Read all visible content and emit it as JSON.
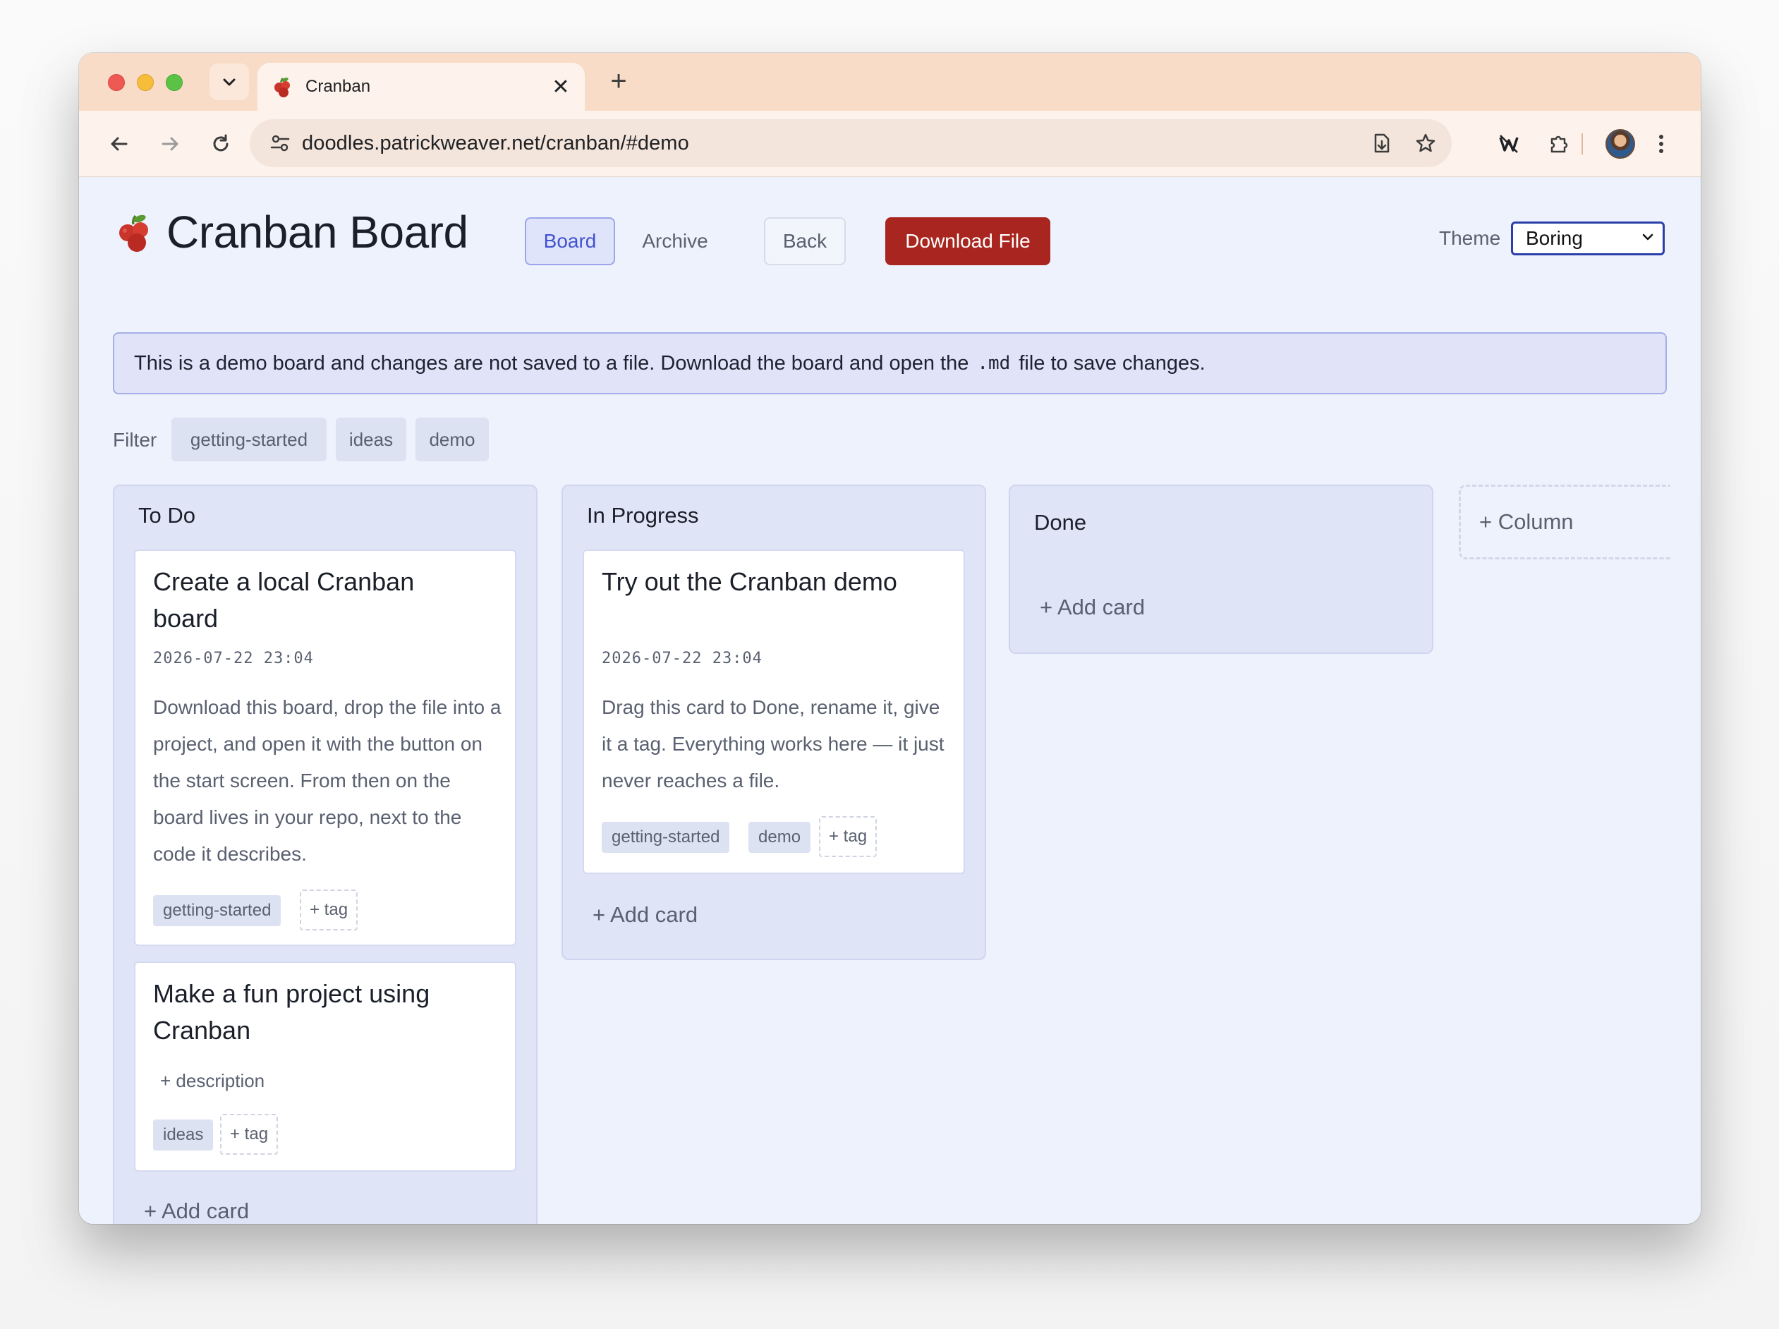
{
  "browser": {
    "tab_title": "Cranban",
    "url": "doodles.patrickweaver.net/cranban/#demo"
  },
  "app": {
    "title": "Cranban Board",
    "nav": {
      "board": "Board",
      "archive": "Archive",
      "back": "Back",
      "download": "Download File"
    },
    "theme": {
      "label": "Theme",
      "selected": "Boring"
    },
    "banner": {
      "text_before": "This is a demo board and changes are not saved to a file. Download the board and open the",
      "code": ".md",
      "text_after": "file to save changes."
    },
    "filter": {
      "label": "Filter",
      "tags": [
        "getting-started",
        "ideas",
        "demo"
      ]
    },
    "columns": [
      {
        "title": "To Do",
        "add_card": "+ Add card",
        "cards": [
          {
            "title": "Create a local Cranban board",
            "date": "2026-07-22 23:04",
            "description": "Download this board, drop the file into a project, and open it with the button on the start screen. From then on the board lives in your repo, next to the code it describes.",
            "tags": [
              "getting-started"
            ],
            "add_tag": "+ tag"
          },
          {
            "title": "Make a fun project using Cranban",
            "add_description": "+ description",
            "tags": [
              "ideas"
            ],
            "add_tag": "+ tag"
          }
        ]
      },
      {
        "title": "In Progress",
        "add_card": "+ Add card",
        "cards": [
          {
            "title": "Try out the Cranban demo",
            "date": "2026-07-22 23:04",
            "description": "Drag this card to Done, rename it, give it a tag. Everything works here — it just never reaches a file.",
            "tags": [
              "getting-started",
              "demo"
            ],
            "add_tag": "+ tag"
          }
        ]
      },
      {
        "title": "Done",
        "add_card": "+ Add card",
        "cards": []
      }
    ],
    "add_column": "+ Column"
  },
  "colors": {
    "accent": "#4353d0",
    "download_button": "#a8261f",
    "page_bg": "#eef2fc",
    "column_bg": "#dfe4f7",
    "tab_strip": "#f9dcc8"
  }
}
